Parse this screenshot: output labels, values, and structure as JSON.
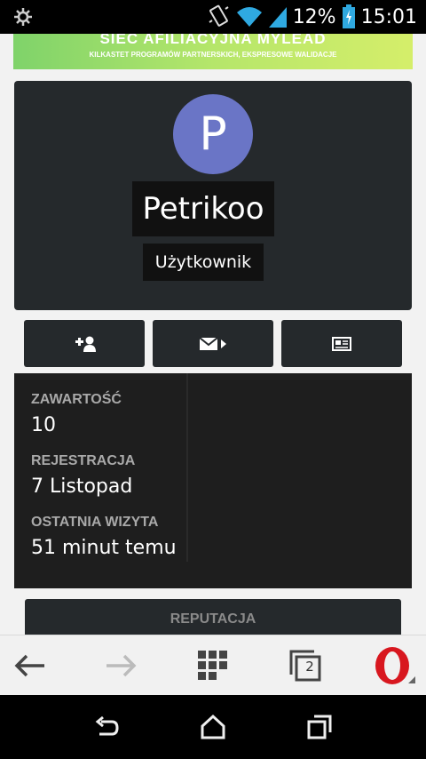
{
  "status_bar": {
    "battery": "12%",
    "time": "15:01",
    "icons": [
      "settings-wheel-icon",
      "vibrate-icon",
      "wifi-icon",
      "signal-icon",
      "battery-icon"
    ]
  },
  "banner": {
    "title": "SIEĆ AFILIACYJNA MYLEAD",
    "subtitle": "KILKASTET PROGRAMÓW PARTNERSKICH, EKSPRESOWE WALIDACJE"
  },
  "profile": {
    "avatar_letter": "P",
    "avatar_color": "#6a75c6",
    "username": "Petrikoo",
    "role": "Użytkownik"
  },
  "actions": {
    "icons": [
      "add-friend-icon",
      "send-message-icon",
      "newspaper-icon"
    ]
  },
  "stats": {
    "content_label": "ZAWARTOŚĆ",
    "content_value": "10",
    "registration_label": "REJESTRACJA",
    "registration_value": "7 Listopad",
    "last_visit_label": "OSTATNIA WIZYTA",
    "last_visit_value": "51 minut temu"
  },
  "reputation": {
    "label": "REPUTACJA"
  },
  "browser_toolbar": {
    "tabs_count": "2",
    "icons": [
      "back-arrow-icon",
      "forward-arrow-icon",
      "speed-dial-icon",
      "tabs-icon",
      "opera-menu-icon"
    ]
  },
  "system_nav": {
    "icons": [
      "system-back-icon",
      "home-icon",
      "recents-icon"
    ]
  }
}
